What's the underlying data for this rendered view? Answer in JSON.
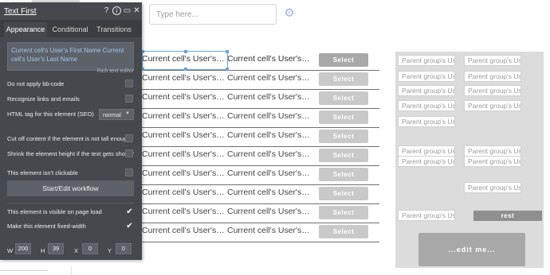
{
  "canvas": {
    "top_input_placeholder": "Type here...",
    "gear_icon": "gear-icon",
    "rows": [
      {
        "first": "Current cell's User's First Name",
        "second": "Current cell's User's Ho...",
        "button": "Select"
      },
      {
        "first": "Current cell's User's Fir...",
        "second": "Current cell's User's Ho...",
        "button": "Select"
      },
      {
        "first": "Current cell's User's Fir...",
        "second": "Current cell's User's Ho...",
        "button": "Select"
      },
      {
        "first": "Current cell's User's Fir...",
        "second": "Current cell's User's Ho...",
        "button": "Select"
      },
      {
        "first": "Current cell's User's Fir...",
        "second": "Current cell's User's Ho...",
        "button": "Select"
      },
      {
        "first": "Current cell's User's Fir...",
        "second": "Current cell's User's Ho...",
        "button": "Select"
      },
      {
        "first": "Current cell's User's Fir...",
        "second": "Current cell's User's Ho...",
        "button": "Select"
      },
      {
        "first": "Current cell's User's Fir...",
        "second": "Current cell's User's Ho...",
        "button": "Select"
      },
      {
        "first": "Current cell's User's Fir...",
        "second": "Current cell's User's Ho...",
        "button": "Select"
      },
      {
        "first": "Current cell's User's Fir...",
        "second": "Current cell's User's Ho...",
        "button": "Select"
      }
    ],
    "parent_group_label": "Parent group's Us",
    "rest_button": "rest",
    "edit_button": "...edit me..."
  },
  "editor": {
    "title": "Text First",
    "icons": [
      "help-icon",
      "info-icon",
      "comment-icon",
      "close-icon"
    ],
    "tabs": [
      "Appearance",
      "Conditional",
      "Transitions"
    ],
    "rich_text": "Current cell's User's First Name  Current cell's User's Last Name",
    "rich_text_label": "Rich text editor",
    "props": {
      "bbcode": "Do not apply bb-code",
      "links": "Recognize links and emails",
      "seo": "HTML tag for this element (SEO)",
      "seo_value": "normal",
      "cutoff": "Cut off content if the element is not tall enough",
      "shrink": "Shrink the element height if the text gets shorter",
      "not_clickable": "This element isn't clickable",
      "workflow_button": "Start/Edit workflow",
      "visible_on_load": "This element is visible on page load",
      "fixed_width": "Make this element fixed-width"
    },
    "geometry": {
      "w_label": "W",
      "w": "200",
      "h_label": "H",
      "h": "39",
      "x_label": "X",
      "x": "0",
      "y_label": "Y",
      "y": "0"
    }
  }
}
